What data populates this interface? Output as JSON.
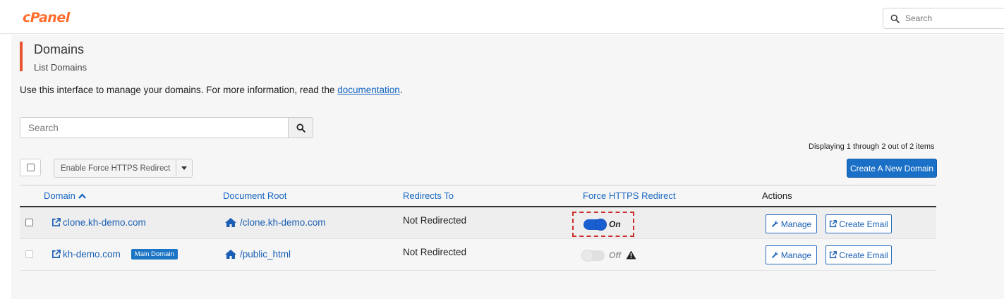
{
  "header": {
    "logo_text": "cPanel",
    "search_placeholder": "Search"
  },
  "page": {
    "title": "Domains",
    "subtitle": "List Domains",
    "intro_text": "Use this interface to manage your domains. For more information, read the ",
    "intro_link": "documentation",
    "intro_end": "."
  },
  "search": {
    "placeholder": "Search"
  },
  "display_info": "Displaying 1 through 2 out of 2 items",
  "bulk_action": {
    "label": "Enable Force HTTPS Redirect"
  },
  "create_button": "Create A New Domain",
  "table": {
    "headers": {
      "domain": "Domain",
      "document_root": "Document Root",
      "redirects_to": "Redirects To",
      "force_https": "Force HTTPS Redirect",
      "actions": "Actions"
    },
    "rows": [
      {
        "domain": "clone.kh-demo.com",
        "document_root": "/clone.kh-demo.com",
        "redirects_to": "Not Redirected",
        "force_https_state": "On",
        "manage_label": "Manage",
        "email_label": "Create Email"
      },
      {
        "domain": "kh-demo.com",
        "badge": "Main Domain",
        "document_root": "/public_html",
        "redirects_to": "Not Redirected",
        "force_https_state": "Off",
        "manage_label": "Manage",
        "email_label": "Create Email"
      }
    ]
  },
  "colors": {
    "brand": "#ff6c2c",
    "accent": "#1a6fc6",
    "title_bar": "#e8542f",
    "highlight_dashed": "#c9302c"
  },
  "icons": [
    "search-icon",
    "external-link-icon",
    "home-icon",
    "wrench-icon",
    "warning-icon",
    "caret-down-icon",
    "sort-up-icon"
  ]
}
